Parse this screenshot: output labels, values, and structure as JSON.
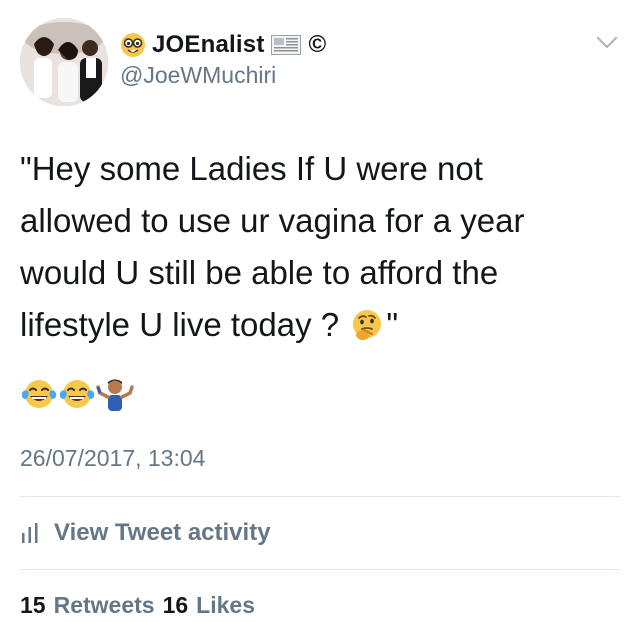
{
  "author": {
    "display_name": "JOEnalist",
    "handle": "@JoeWMuchiri",
    "name_prefix_icon": "nerd-face-emoji-icon",
    "name_suffix_icon": "newspaper-flag-icon",
    "name_suffix_symbol": "©",
    "avatar": "profile-photo"
  },
  "tweet": {
    "lines": [
      "\"Hey some Ladies If U were not",
      "allowed to use ur vagina for a year",
      "would U still be able to afford the",
      "lifestyle U live today ?"
    ],
    "line4_suffix": "\"",
    "inline_emoji": "thinking-face-emoji-icon",
    "emoji_row": [
      "tears-of-joy-emoji-icon",
      "tears-of-joy-emoji-icon",
      "man-shrugging-emoji-icon"
    ]
  },
  "timestamp": "26/07/2017, 13:04",
  "activity": {
    "label": "View Tweet activity",
    "icon": "bar-chart-icon"
  },
  "stats": {
    "retweets_count": "15",
    "retweets_label": "Retweets",
    "likes_count": "16",
    "likes_label": "Likes"
  },
  "colors": {
    "text_primary": "#14171a",
    "text_secondary": "#657786",
    "divider": "#e1e8ed"
  }
}
